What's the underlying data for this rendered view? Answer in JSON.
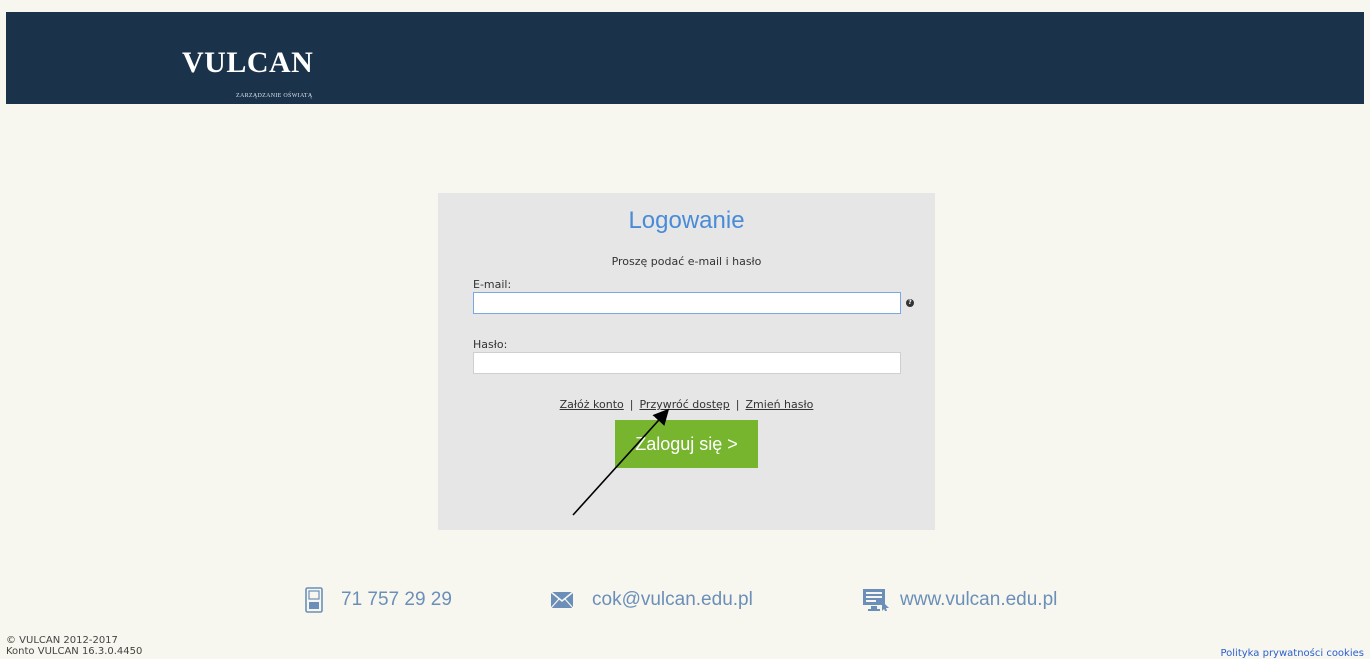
{
  "header": {
    "logo_text": "VULCAN",
    "logo_tagline": "ZARZĄDZANIE OŚWIATĄ"
  },
  "login": {
    "title": "Logowanie",
    "subtitle": "Proszę podać e-mail i hasło",
    "email_label": "E-mail:",
    "email_value": "",
    "password_label": "Hasło:",
    "password_value": "",
    "help_icon": "question-circle-icon",
    "links": {
      "create_account": "Załóż konto",
      "restore_access": "Przywróć dostęp",
      "change_password": "Zmień hasło",
      "separator": "|"
    },
    "submit_label": "Zaloguj się >"
  },
  "contact": {
    "phone": "71 757 29 29",
    "email": "cok@vulcan.edu.pl",
    "website": "www.vulcan.edu.pl"
  },
  "footer": {
    "copyright": "© VULCAN 2012-2017",
    "version": "Konto VULCAN 16.3.0.4450",
    "cookie_policy": "Polityka prywatności cookies"
  },
  "colors": {
    "header_bg": "#1b324b",
    "page_bg": "#f7f7ef",
    "panel_bg": "#e6e6e6",
    "title_blue": "#4a8bd8",
    "button_green": "#77b52f",
    "contact_blue": "#6b8fb8"
  }
}
